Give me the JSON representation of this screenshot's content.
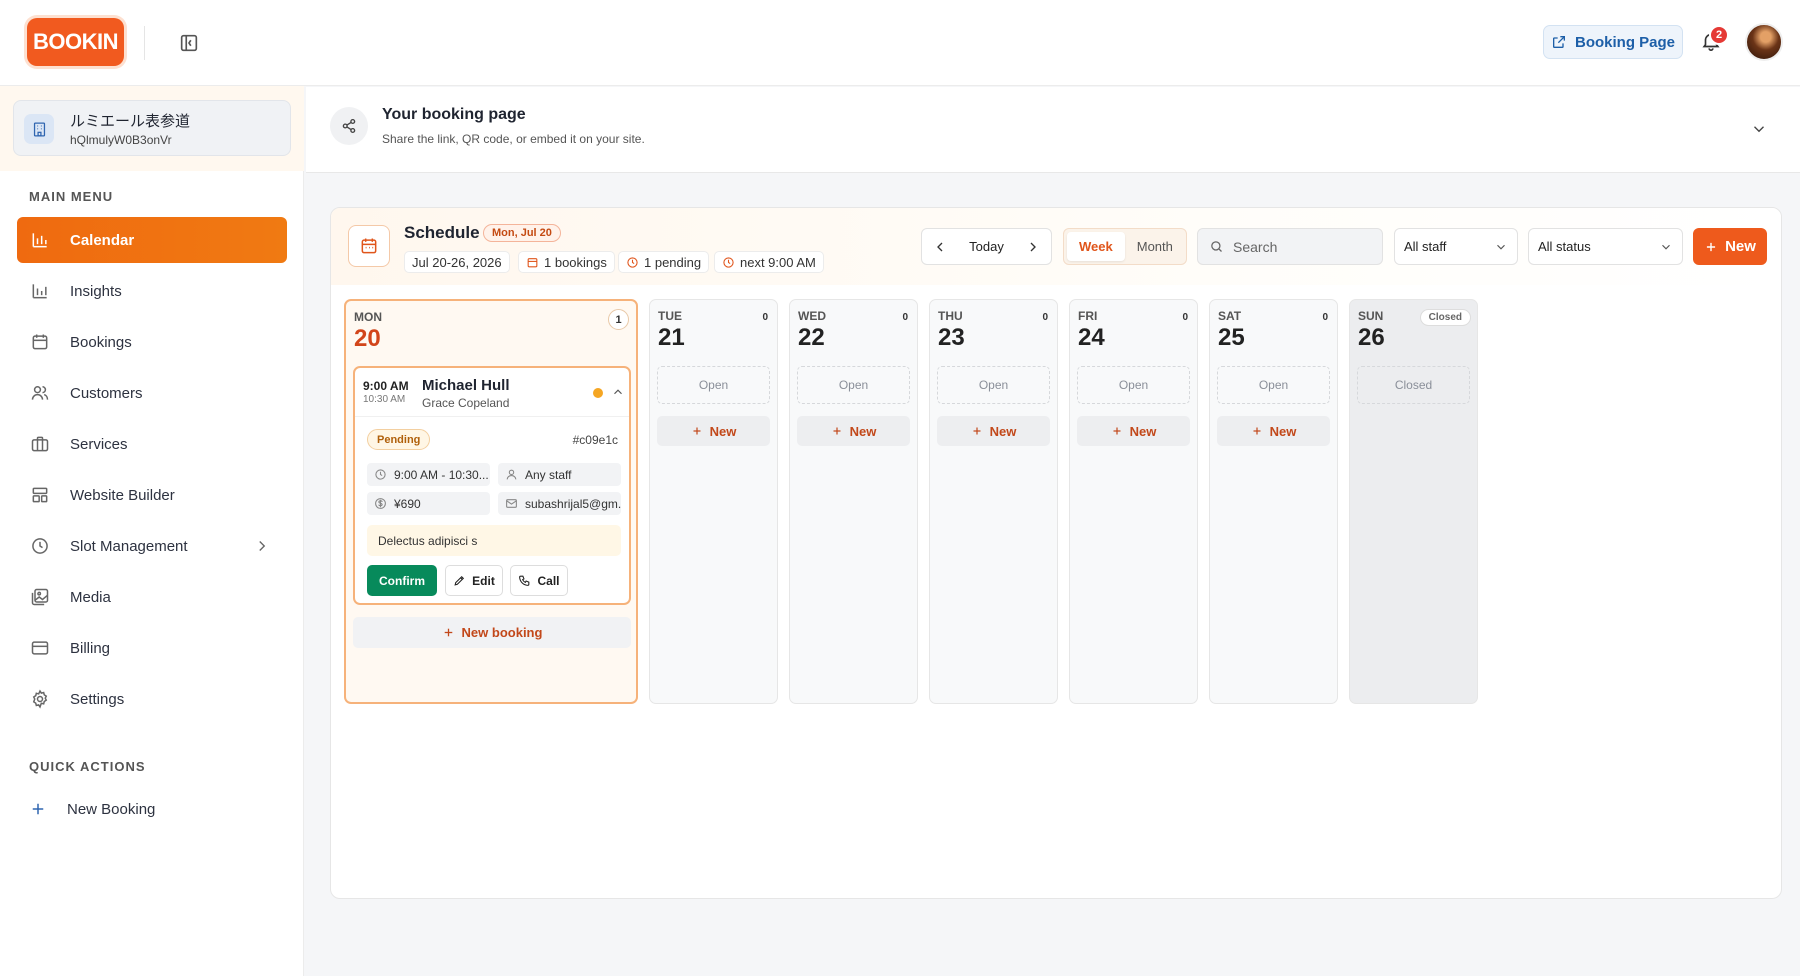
{
  "header": {
    "logo_text": "BOOKIN",
    "booking_page_label": "Booking Page",
    "notification_count": "2"
  },
  "sidebar": {
    "workspace_name": "ルミエール表参道",
    "workspace_id": "hQlmulyW0B3onVr",
    "main_menu_title": "MAIN MENU",
    "items": [
      {
        "label": "Calendar",
        "icon": "bar-chart-icon",
        "active": true
      },
      {
        "label": "Insights",
        "icon": "insights-icon"
      },
      {
        "label": "Bookings",
        "icon": "calendar-icon"
      },
      {
        "label": "Customers",
        "icon": "users-icon"
      },
      {
        "label": "Services",
        "icon": "briefcase-icon"
      },
      {
        "label": "Website Builder",
        "icon": "layout-icon"
      },
      {
        "label": "Slot Management",
        "icon": "clock-icon"
      },
      {
        "label": "Media",
        "icon": "image-icon"
      },
      {
        "label": "Billing",
        "icon": "credit-card-icon"
      },
      {
        "label": "Settings",
        "icon": "gear-icon"
      }
    ],
    "quick_actions_title": "QUICK ACTIONS",
    "quick_actions": [
      {
        "label": "New Booking",
        "icon": "plus-icon"
      }
    ]
  },
  "booking_page": {
    "title": "Your booking page",
    "subtitle": "Share the link, QR code, or embed it on your site."
  },
  "schedule": {
    "title": "Schedule",
    "date_badge": "Mon, Jul 20",
    "range": "Jul 20-26, 2026",
    "bookings_chip": "1 bookings",
    "pending_chip": "1 pending",
    "next_chip": "next 9:00 AM",
    "today_label": "Today",
    "view_week": "Week",
    "view_month": "Month",
    "active_view": "Week",
    "search_placeholder": "Search",
    "staff_filter": "All staff",
    "status_filter": "All status",
    "new_label": "New",
    "days": [
      {
        "dow": "MON",
        "num": "20",
        "count": "1"
      },
      {
        "dow": "TUE",
        "num": "21",
        "count": "0",
        "slot": "Open",
        "new": "New"
      },
      {
        "dow": "WED",
        "num": "22",
        "count": "0",
        "slot": "Open",
        "new": "New"
      },
      {
        "dow": "THU",
        "num": "23",
        "count": "0",
        "slot": "Open",
        "new": "New"
      },
      {
        "dow": "FRI",
        "num": "24",
        "count": "0",
        "slot": "Open",
        "new": "New"
      },
      {
        "dow": "SAT",
        "num": "25",
        "count": "0",
        "slot": "Open",
        "new": "New"
      },
      {
        "dow": "SUN",
        "num": "26",
        "count": "Closed",
        "slot": "Closed"
      }
    ],
    "booking": {
      "start": "9:00 AM",
      "end": "10:30 AM",
      "customer": "Michael Hull",
      "staff": "Grace Copeland",
      "status": "Pending",
      "id": "#c09e1c",
      "time_range": "9:00 AM - 10:30...",
      "staff_pref": "Any staff",
      "price": "¥690",
      "email": "subashrijal5@gm...",
      "note": "Delectus adipisci s",
      "confirm_label": "Confirm",
      "edit_label": "Edit",
      "call_label": "Call"
    },
    "new_booking_label": "New booking"
  },
  "colors": {
    "accent": "#ee5a1c",
    "confirm": "#078a5b",
    "pending_dot": "#f5a623"
  }
}
